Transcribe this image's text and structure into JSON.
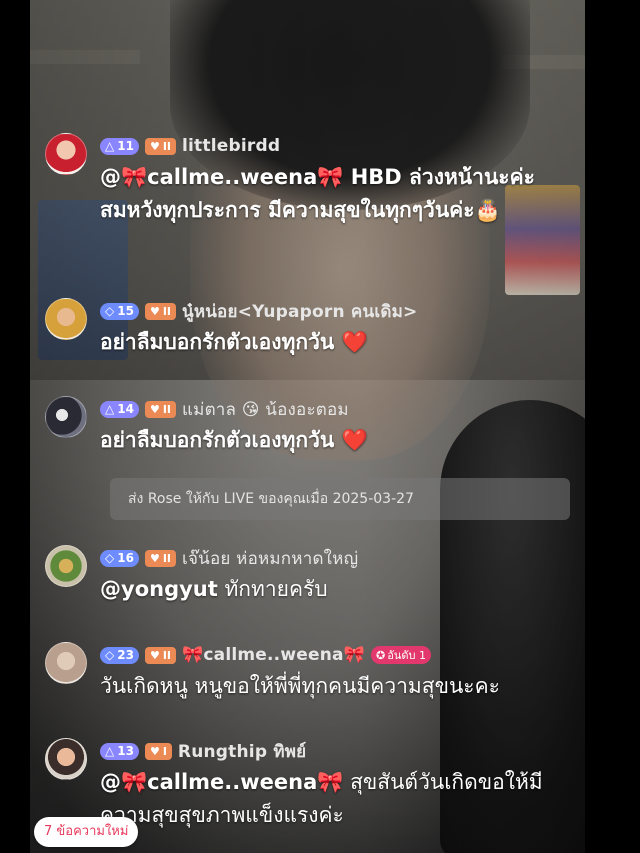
{
  "messages": [
    {
      "avatar": "avatar-woman-red-dress",
      "level": "11",
      "fan_level": "II",
      "username": "littlebirdd",
      "text_mention": "@🎀callme..weena🎀",
      "text_body": " HBD ล่วงหน้านะค่ะ สมหวังทุกประการ มีความสุขในทุกๆวันค่ะ",
      "text_emoji": "🎂"
    },
    {
      "avatar": "avatar-woman-yellow",
      "level": "15",
      "fan_level": "II",
      "username": "นู๋หน่อย<Yupaporn คนเดิม>",
      "text_body": "อย่าลืมบอกรักตัวเองทุกวัน ",
      "text_heart": "❤️"
    },
    {
      "avatar": "avatar-mask-dark",
      "level": "14",
      "fan_level": "II",
      "username": "แม่ตาล 😘 น้องอะตอม",
      "text_body": "อย่าลืมบอกรักตัวเองทุกวัน ",
      "text_heart": "❤️"
    },
    {
      "avatar": "avatar-food-plate",
      "level": "16",
      "fan_level": "II",
      "username": "เจ๊น้อย  ห่อหมกหาดใหญ่",
      "text_mention": "@yongyut",
      "text_body": " ทักทายครับ"
    },
    {
      "avatar": "avatar-person-light",
      "level": "23",
      "fan_level": "II",
      "username": "🎀callme..weena🎀",
      "rank_badge": "อันดับ 1",
      "text_body": "วันเกิดหนู หนูขอให้พี่พี่ทุกคนมีความสุขนะคะ"
    },
    {
      "avatar": "avatar-woman-smiling",
      "level": "13",
      "fan_level": "I",
      "username": "Rungthip ทิพย์",
      "text_mention": "@🎀callme..weena🎀",
      "text_body": " สุขสันต์วันเกิดขอให้มีความสุขสุขภาพแข็งแรงค่ะ"
    }
  ],
  "gift_banner": "ส่ง Rose ให้กับ LIVE ของคุณเมื่อ 2025-03-27",
  "new_messages_label": "7 ข้อความใหม่",
  "colors": {
    "level_badge": "#8a86ff",
    "fan_badge": "#ec8a55",
    "rank_badge": "#e2386d",
    "new_messages_text": "#e73a5c"
  }
}
